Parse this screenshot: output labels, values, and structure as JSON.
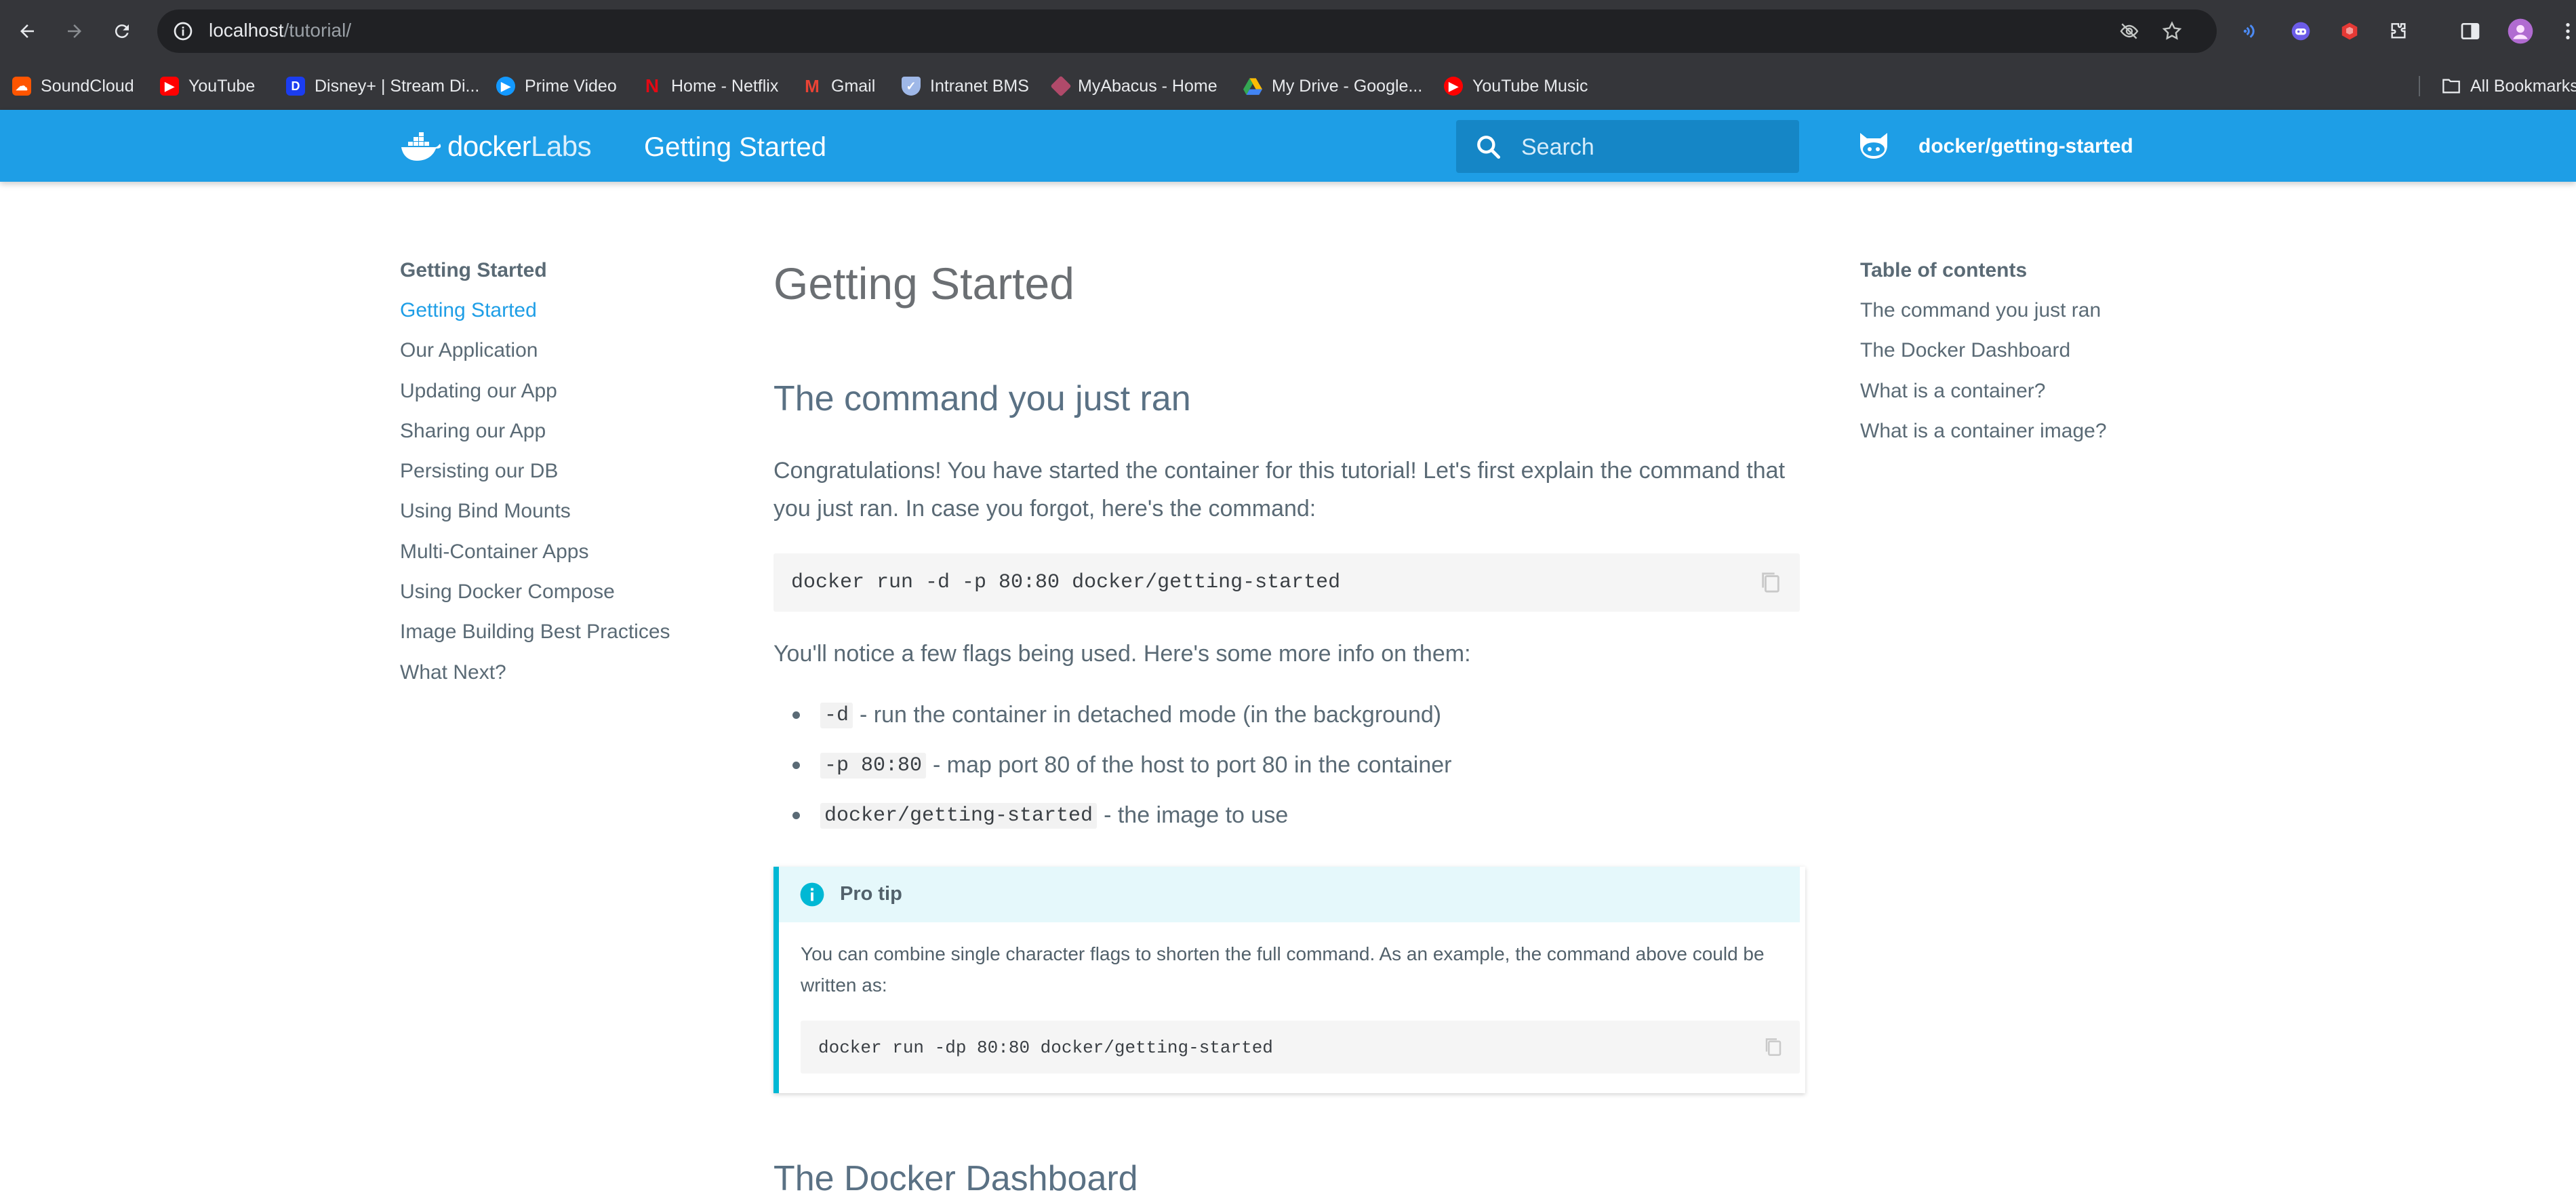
{
  "browser": {
    "url_host": "localhost",
    "url_path": "/tutorial/",
    "bookmarks": [
      {
        "label": "SoundCloud",
        "icon": "soundcloud-icon",
        "color": "#ff5500"
      },
      {
        "label": "YouTube",
        "icon": "youtube-icon",
        "color": "#ff0000"
      },
      {
        "label": "Disney+ | Stream Di...",
        "icon": "disney-plus-icon",
        "color": "#1b3df0"
      },
      {
        "label": "Prime Video",
        "icon": "prime-video-icon",
        "color": "#1399ff"
      },
      {
        "label": "Home - Netflix",
        "icon": "netflix-icon",
        "color": "#e50914"
      },
      {
        "label": "Gmail",
        "icon": "gmail-icon",
        "color": "#ea4335"
      },
      {
        "label": "Intranet BMS",
        "icon": "shield-icon",
        "color": "#9fb8e8"
      },
      {
        "label": "MyAbacus - Home",
        "icon": "abacus-icon",
        "color": "#b04a6a"
      },
      {
        "label": "My Drive - Google...",
        "icon": "google-drive-icon",
        "color": "#34a853"
      },
      {
        "label": "YouTube Music",
        "icon": "youtube-music-icon",
        "color": "#ff0000"
      }
    ],
    "all_bookmarks_label": "All Bookmarks"
  },
  "site": {
    "logo_main": "docker",
    "logo_sub": "Labs",
    "header_title": "Getting Started",
    "search_placeholder": "Search",
    "repo_label": "docker/getting-started",
    "brand_color": "#1e9ee6"
  },
  "left_nav": {
    "heading": "Getting Started",
    "items": [
      {
        "label": "Getting Started",
        "active": true
      },
      {
        "label": "Our Application"
      },
      {
        "label": "Updating our App"
      },
      {
        "label": "Sharing our App"
      },
      {
        "label": "Persisting our DB"
      },
      {
        "label": "Using Bind Mounts"
      },
      {
        "label": "Multi-Container Apps"
      },
      {
        "label": "Using Docker Compose"
      },
      {
        "label": "Image Building Best Practices"
      },
      {
        "label": "What Next?"
      }
    ]
  },
  "toc": {
    "heading": "Table of contents",
    "items": [
      "The command you just ran",
      "The Docker Dashboard",
      "What is a container?",
      "What is a container image?"
    ]
  },
  "article": {
    "title": "Getting Started",
    "section1_heading": "The command you just ran",
    "intro": "Congratulations! You have started the container for this tutorial! Let's first explain the command that you just ran. In case you forgot, here's the command:",
    "command": "docker run -d -p 80:80 docker/getting-started",
    "flags_intro": "You'll notice a few flags being used. Here's some more info on them:",
    "flags": [
      {
        "code": "-d",
        "text": "- run the container in detached mode (in the background)"
      },
      {
        "code": "-p 80:80",
        "text": "- map port 80 of the host to port 80 in the container"
      },
      {
        "code": "docker/getting-started",
        "text": "- the image to use"
      }
    ],
    "protip": {
      "title": "Pro tip",
      "text": "You can combine single character flags to shorten the full command. As an example, the command above could be written as:",
      "command": "docker run -dp 80:80 docker/getting-started"
    },
    "section2_heading": "The Docker Dashboard"
  }
}
